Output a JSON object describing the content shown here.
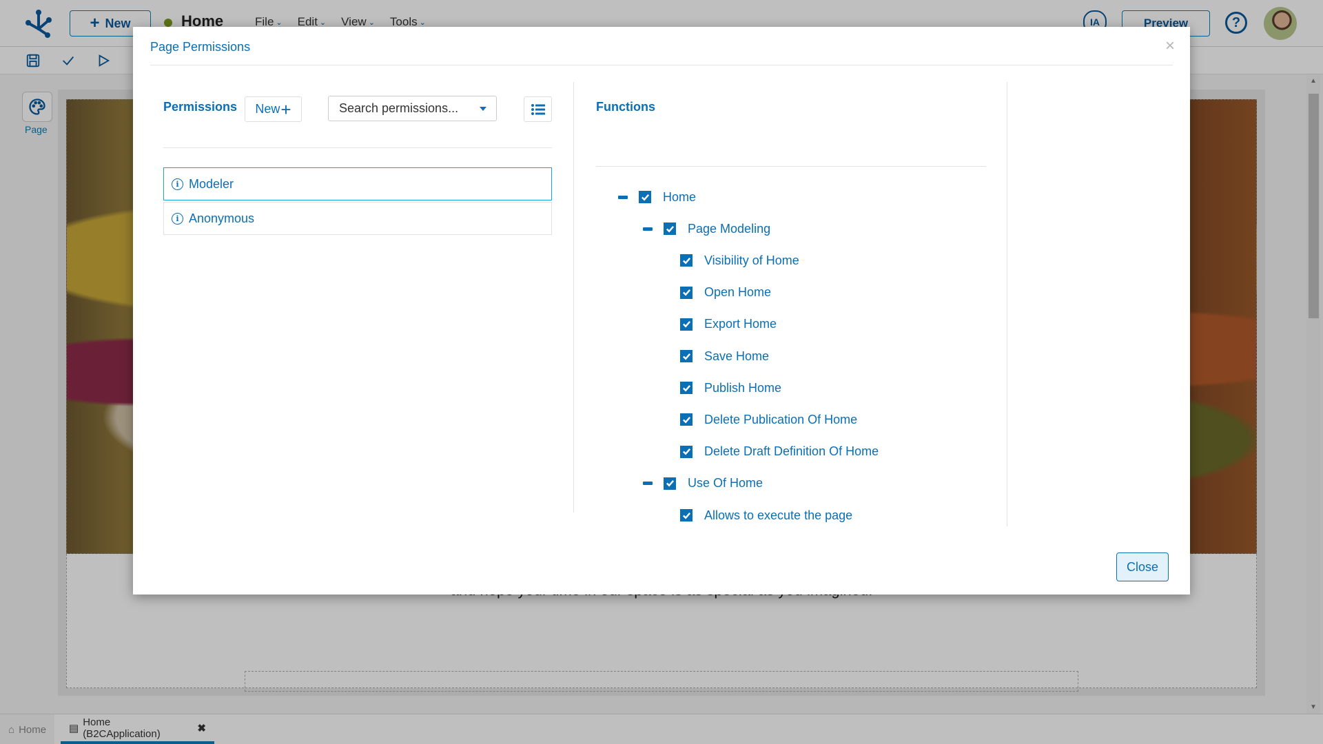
{
  "app": {
    "new_label": "New",
    "doc_title": "Home",
    "doc_status_color": "#7a9b1e",
    "menu": [
      {
        "label": "File"
      },
      {
        "label": "Edit"
      },
      {
        "label": "View"
      },
      {
        "label": "Tools"
      }
    ],
    "ia_label": "IA",
    "preview_label": "Preview",
    "help_label": "?",
    "left_panel": {
      "page_label": "Page"
    },
    "canvas_text": "and hope your time in our space is as special as you imagined."
  },
  "bottom_tabs": [
    {
      "label": "Home",
      "icon": "home-icon"
    },
    {
      "label": "Home (B2CApplication)",
      "icon": "page-icon",
      "close": "✖"
    }
  ],
  "modal": {
    "title": "Page Permissions",
    "close_x": "×",
    "permissions": {
      "header": "Permissions",
      "new_label": "New",
      "new_icon": "+",
      "search_placeholder": "Search permissions...",
      "items": [
        {
          "label": "Modeler",
          "selected": true
        },
        {
          "label": "Anonymous",
          "selected": false
        }
      ]
    },
    "functions": {
      "header": "Functions",
      "tree": [
        {
          "label": "Home",
          "level": 0,
          "collapsible": true,
          "checked": true
        },
        {
          "label": "Page Modeling",
          "level": 1,
          "collapsible": true,
          "checked": true
        },
        {
          "label": "Visibility of Home",
          "level": 2,
          "collapsible": false,
          "checked": true
        },
        {
          "label": "Open Home",
          "level": 2,
          "collapsible": false,
          "checked": true
        },
        {
          "label": "Export Home",
          "level": 2,
          "collapsible": false,
          "checked": true
        },
        {
          "label": "Save Home",
          "level": 2,
          "collapsible": false,
          "checked": true
        },
        {
          "label": "Publish Home",
          "level": 2,
          "collapsible": false,
          "checked": true
        },
        {
          "label": "Delete Publication Of Home",
          "level": 2,
          "collapsible": false,
          "checked": true
        },
        {
          "label": "Delete Draft Definition Of Home",
          "level": 2,
          "collapsible": false,
          "checked": true
        },
        {
          "label": "Use Of Home",
          "level": 1,
          "collapsible": true,
          "checked": true
        },
        {
          "label": "Allows to execute the page",
          "level": 2,
          "collapsible": false,
          "checked": true
        }
      ]
    },
    "close_label": "Close"
  },
  "colors": {
    "accent": "#0a6fb5",
    "selected_border": "#1aa3d9",
    "close_bg": "#e3f1fb"
  }
}
